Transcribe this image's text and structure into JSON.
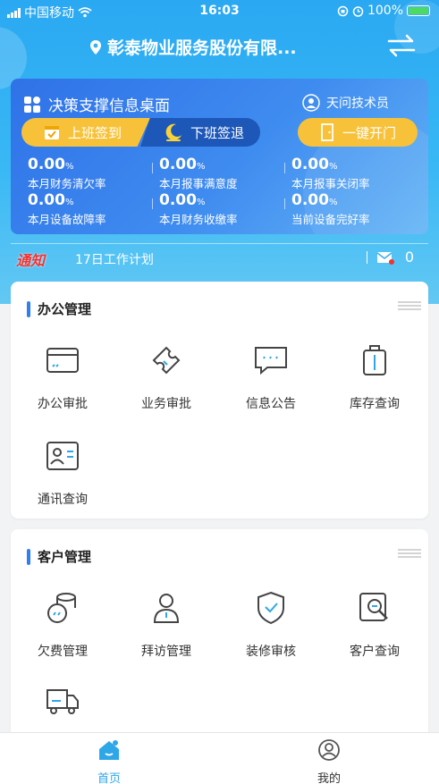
{
  "status_bar": {
    "carrier": "中国移动",
    "time": "16:03",
    "battery": "100%"
  },
  "header": {
    "title": "彰泰物业服务股份有限...",
    "location_icon": "location-pin-icon",
    "switch_icon": "swap-arrows-icon"
  },
  "panel": {
    "title": "决策支撑信息桌面",
    "user": "天问技术员",
    "checkin_label": "上班签到",
    "checkout_label": "下班签退",
    "door_label": "一键开门",
    "stats": [
      {
        "value": "0.00",
        "unit": "%",
        "label": "本月财务清欠率"
      },
      {
        "value": "0.00",
        "unit": "%",
        "label": "本月报事满意度"
      },
      {
        "value": "0.00",
        "unit": "%",
        "label": "本月报事关闭率"
      },
      {
        "value": "0.00",
        "unit": "%",
        "label": "本月设备故障率"
      },
      {
        "value": "0.00",
        "unit": "%",
        "label": "本月财务收缴率"
      },
      {
        "value": "0.00",
        "unit": "%",
        "label": "当前设备完好率"
      }
    ]
  },
  "notice": {
    "logo": "通知",
    "text": "17日工作计划",
    "count": "0"
  },
  "office": {
    "title": "办公管理",
    "items": [
      {
        "label": "办公审批",
        "icon": "card-icon"
      },
      {
        "label": "业务审批",
        "icon": "ticket-icon"
      },
      {
        "label": "信息公告",
        "icon": "message-icon"
      },
      {
        "label": "库存查询",
        "icon": "luggage-icon"
      },
      {
        "label": "通讯查询",
        "icon": "contact-card-icon"
      }
    ]
  },
  "customer": {
    "title": "客户管理",
    "items": [
      {
        "label": "欠费管理",
        "icon": "coins-icon"
      },
      {
        "label": "拜访管理",
        "icon": "person-icon"
      },
      {
        "label": "装修审核",
        "icon": "shield-check-icon"
      },
      {
        "label": "客户查询",
        "icon": "search-doc-icon"
      },
      {
        "label": "",
        "icon": "truck-icon"
      }
    ]
  },
  "tabbar": {
    "home": "首页",
    "mine": "我的"
  },
  "colors": {
    "accent": "#2f80ed",
    "icon_accent": "#2ea7e8",
    "gold": "#f7c23a"
  }
}
